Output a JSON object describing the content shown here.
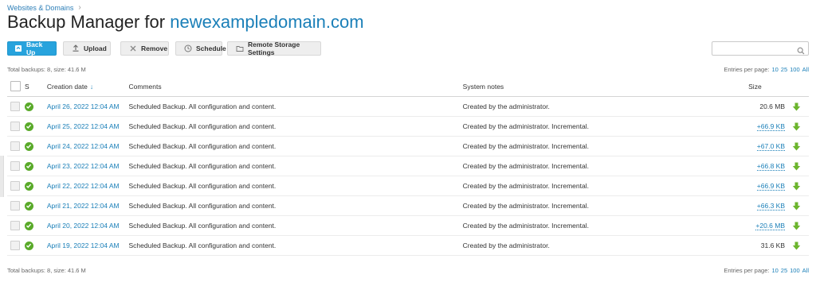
{
  "breadcrumb": {
    "item": "Websites & Domains"
  },
  "title": {
    "prefix": "Backup Manager for",
    "domain": "newexampledomain.com"
  },
  "toolbar": {
    "backup_label": "Back Up",
    "upload_label": "Upload",
    "remove_label": "Remove",
    "schedule_label": "Schedule",
    "remote_label": "Remote Storage Settings"
  },
  "search": {
    "value": "",
    "placeholder": ""
  },
  "summary": "Total backups: 8, size: 41.6 M",
  "pagination": {
    "label": "Entries per page:",
    "options": [
      "10",
      "25",
      "100",
      "All"
    ]
  },
  "table": {
    "headers": {
      "status": "S",
      "date": "Creation date",
      "comments": "Comments",
      "notes": "System notes",
      "size": "Size"
    },
    "sort_indicator": "↓",
    "rows": [
      {
        "date": "April 26, 2022 12:04 AM",
        "comment": "Scheduled Backup. All configuration and content.",
        "notes": "Created by the administrator.",
        "size": "20.6 MB",
        "incremental": false
      },
      {
        "date": "April 25, 2022 12:04 AM",
        "comment": "Scheduled Backup. All configuration and content.",
        "notes": "Created by the administrator. Incremental.",
        "size": "+66.9 KB",
        "incremental": true
      },
      {
        "date": "April 24, 2022 12:04 AM",
        "comment": "Scheduled Backup. All configuration and content.",
        "notes": "Created by the administrator. Incremental.",
        "size": "+67.0 KB",
        "incremental": true
      },
      {
        "date": "April 23, 2022 12:04 AM",
        "comment": "Scheduled Backup. All configuration and content.",
        "notes": "Created by the administrator. Incremental.",
        "size": "+66.8 KB",
        "incremental": true
      },
      {
        "date": "April 22, 2022 12:04 AM",
        "comment": "Scheduled Backup. All configuration and content.",
        "notes": "Created by the administrator. Incremental.",
        "size": "+66.9 KB",
        "incremental": true
      },
      {
        "date": "April 21, 2022 12:04 AM",
        "comment": "Scheduled Backup. All configuration and content.",
        "notes": "Created by the administrator. Incremental.",
        "size": "+66.3 KB",
        "incremental": true
      },
      {
        "date": "April 20, 2022 12:04 AM",
        "comment": "Scheduled Backup. All configuration and content.",
        "notes": "Created by the administrator. Incremental.",
        "size": "+20.6 MB",
        "incremental": true
      },
      {
        "date": "April 19, 2022 12:04 AM",
        "comment": "Scheduled Backup. All configuration and content.",
        "notes": "Created by the administrator.",
        "size": "31.6 KB",
        "incremental": false
      }
    ]
  },
  "colors": {
    "accent": "#27a3dd",
    "link": "#1a7fb8",
    "success": "#5aaa2a",
    "download": "#6cb52d"
  },
  "icons": {
    "backup": "backup-icon",
    "upload": "upload-icon",
    "remove": "remove-icon",
    "schedule": "clock-icon",
    "remote": "folder-icon",
    "search": "search-icon",
    "status": "check-circle-icon",
    "download": "download-arrow-icon"
  }
}
